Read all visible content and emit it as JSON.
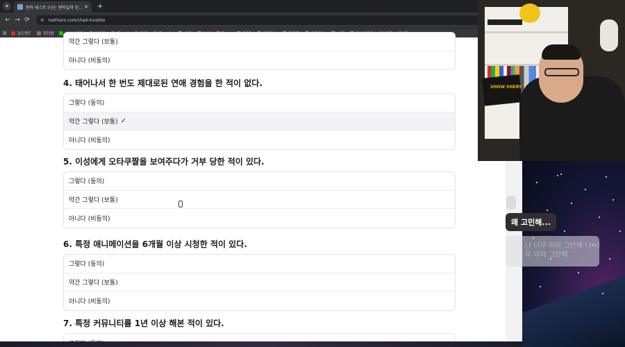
{
  "browser": {
    "tab_title": "찐따 테스트 (나는 찐따일까 인...",
    "tab_close": "✕",
    "new_tab": "+",
    "url": "testharo.com/chad-incel/ko",
    "nav": {
      "back": "←",
      "forward": "→",
      "reload": "⟳",
      "site_info": "⊜",
      "zoom": "🔍",
      "star": "☆"
    },
    "bookmarks_apps_icon": "⊞",
    "bookmarks": [
      {
        "label": "김도랜드",
        "color": "#d93025"
      },
      {
        "label": "최지원",
        "color": "#8d6e63"
      },
      {
        "label": "네이버웨일",
        "color": "#1ec800"
      },
      {
        "label": "아이템",
        "color": "#4285f4"
      },
      {
        "label": "Gmail",
        "color": "#ea4335"
      },
      {
        "label": "카페",
        "color": "#2db400"
      },
      {
        "label": "Google",
        "color": "#4285f4"
      },
      {
        "label": "설정",
        "color": "#9e9e9e"
      },
      {
        "label": "숲빅",
        "color": "#9e9e9e"
      },
      {
        "label": "Suno",
        "color": "#f57c00"
      },
      {
        "label": "NAS",
        "color": "#9e9e9e"
      },
      {
        "label": "게임정보",
        "color": "#9e9e9e"
      },
      {
        "label": "한글화",
        "color": "#9e9e9e"
      },
      {
        "label": "기타정보",
        "color": "#9e9e9e"
      },
      {
        "label": "서류",
        "color": "#9e9e9e"
      },
      {
        "label": "커스터그램",
        "color": "#9e9e9e"
      },
      {
        "label": "쿠팡",
        "color": "#e53935"
      },
      {
        "label": "챗GPT",
        "color": "#10a37f"
      }
    ]
  },
  "quiz": {
    "partial_options": [
      "약간 그렇다 (보통)",
      "아니다 (비동의)"
    ],
    "questions": [
      {
        "title": "4. 태어나서 한 번도 제대로된 연애 경험을 한 적이 없다.",
        "options": [
          "그렇다 (동의)",
          "약간 그렇다 (보통)",
          "아니다 (비동의)"
        ],
        "selected_index": 1
      },
      {
        "title": "5. 이성에게 오타쿠짤을 보여주다가 거부 당한 적이 있다.",
        "options": [
          "그렇다 (동의)",
          "약간 그렇다 (보통)",
          "아니다 (비동의)"
        ],
        "selected_index": -1
      },
      {
        "title": "6. 특정 애니메이션을 6개월 이상 시청한 적이 있다.",
        "options": [
          "그렇다 (동의)",
          "약간 그렇다 (보통)",
          "아니다 (비동의)"
        ],
        "selected_index": -1
      },
      {
        "title": "7. 특정 커뮤니티를 1년 이상 해본 적이 있다.",
        "options": [
          "그렇다 (동의)"
        ],
        "selected_index": -1
      }
    ],
    "check_mark": "✓"
  },
  "webcam": {
    "sign_text": "SHOW SHERY"
  },
  "chat": {
    "bubble": "왜 고민해...",
    "faded_message": "나 너무 아파 그만해 나 너무 아파 그만해"
  }
}
